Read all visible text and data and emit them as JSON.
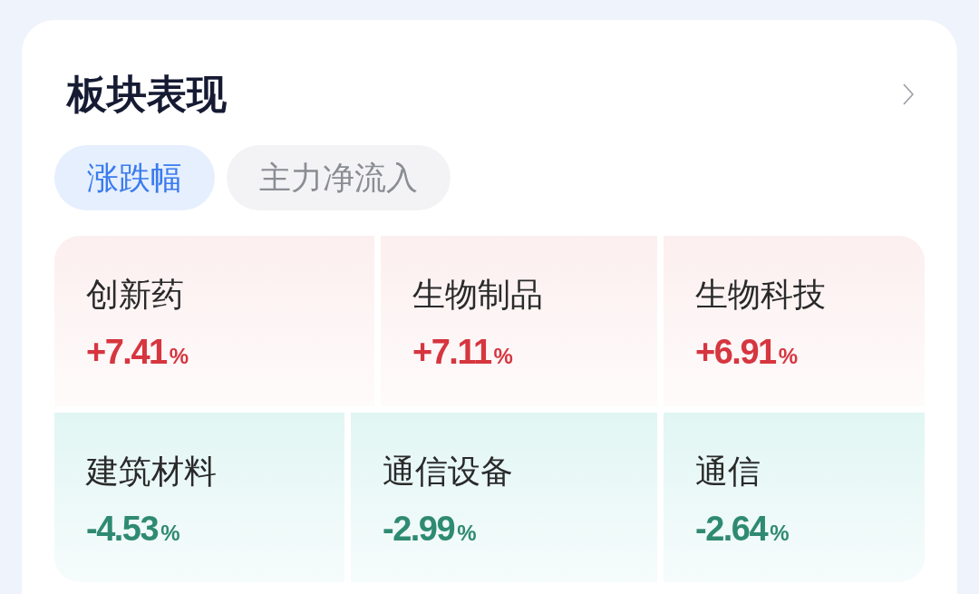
{
  "header": {
    "title": "板块表现"
  },
  "tabs": [
    {
      "label": "涨跌幅",
      "selected": true
    },
    {
      "label": "主力净流入",
      "selected": false
    }
  ],
  "sectors": [
    {
      "cells": [
        {
          "name": "创新药",
          "change": "+7.41",
          "unit": "%",
          "kind": "up"
        },
        {
          "name": "生物制品",
          "change": "+7.11",
          "unit": "%",
          "kind": "up"
        },
        {
          "name": "生物科技",
          "change": "+6.91",
          "unit": "%",
          "kind": "up"
        }
      ]
    },
    {
      "cells": [
        {
          "name": "建筑材料",
          "change": "-4.53",
          "unit": "%",
          "kind": "down"
        },
        {
          "name": "通信设备",
          "change": "-2.99",
          "unit": "%",
          "kind": "down"
        },
        {
          "name": "通信",
          "change": "-2.64",
          "unit": "%",
          "kind": "down"
        }
      ]
    }
  ]
}
